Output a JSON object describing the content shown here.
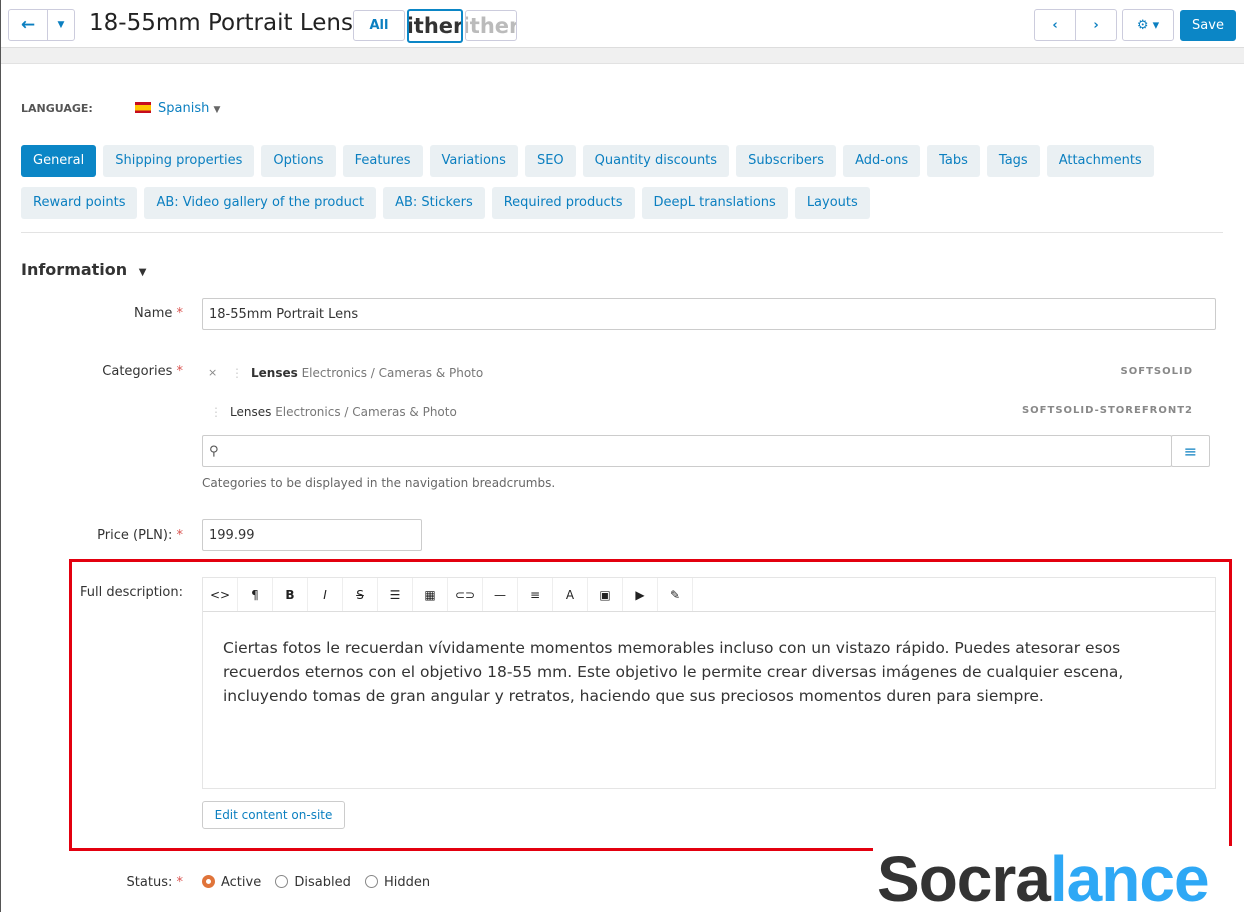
{
  "header": {
    "title": "18-55mm Portrait Lens",
    "all_label": "All",
    "thumb_text": "ither",
    "save_label": "Save"
  },
  "language": {
    "label": "LANGUAGE:",
    "value": "Spanish"
  },
  "tabs_row1": [
    "General",
    "Shipping properties",
    "Options",
    "Features",
    "Variations",
    "SEO",
    "Quantity discounts",
    "Subscribers",
    "Add-ons",
    "Tabs",
    "Tags",
    "Attachments"
  ],
  "tabs_row2": [
    "Reward points",
    "AB: Video gallery of the product",
    "AB: Stickers",
    "Required products",
    "DeepL translations",
    "Layouts"
  ],
  "section": {
    "title": "Information"
  },
  "name": {
    "label": "Name",
    "value": "18-55mm Portrait Lens"
  },
  "categories": {
    "label": "Categories",
    "items": [
      {
        "name": "Lenses",
        "path": "Electronics / Cameras & Photo",
        "store": "SOFTSOLID"
      },
      {
        "name": "Lenses",
        "path": "Electronics / Cameras & Photo",
        "store": "SOFTSOLID-STOREFRONT2"
      }
    ],
    "hint": "Categories to be displayed in the navigation breadcrumbs."
  },
  "price": {
    "label": "Price (PLN):",
    "value": "199.99"
  },
  "description": {
    "label": "Full description:",
    "text": "Ciertas fotos le recuerdan vívidamente momentos memorables incluso con un vistazo rápido. Puedes atesorar esos recuerdos eternos con el objetivo 18-55 mm. Este objetivo le permite crear diversas imágenes de cualquier escena, incluyendo tomas de gran angular y retratos, haciendo que sus preciosos momentos duren para siempre.",
    "edit_label": "Edit content on-site",
    "toolbar": [
      "<>",
      "¶",
      "B",
      "I",
      "S",
      "☰",
      "▦",
      "⊂⊃",
      "—",
      "≡",
      "A",
      "▣",
      "▶",
      "✎"
    ]
  },
  "status": {
    "label": "Status:",
    "options": [
      "Active",
      "Disabled",
      "Hidden"
    ],
    "selected": "Active"
  },
  "watermark": {
    "dark": "Socra",
    "light": "lance"
  },
  "colors": {
    "accent": "#0b86c6",
    "highlight": "#e3000f"
  }
}
